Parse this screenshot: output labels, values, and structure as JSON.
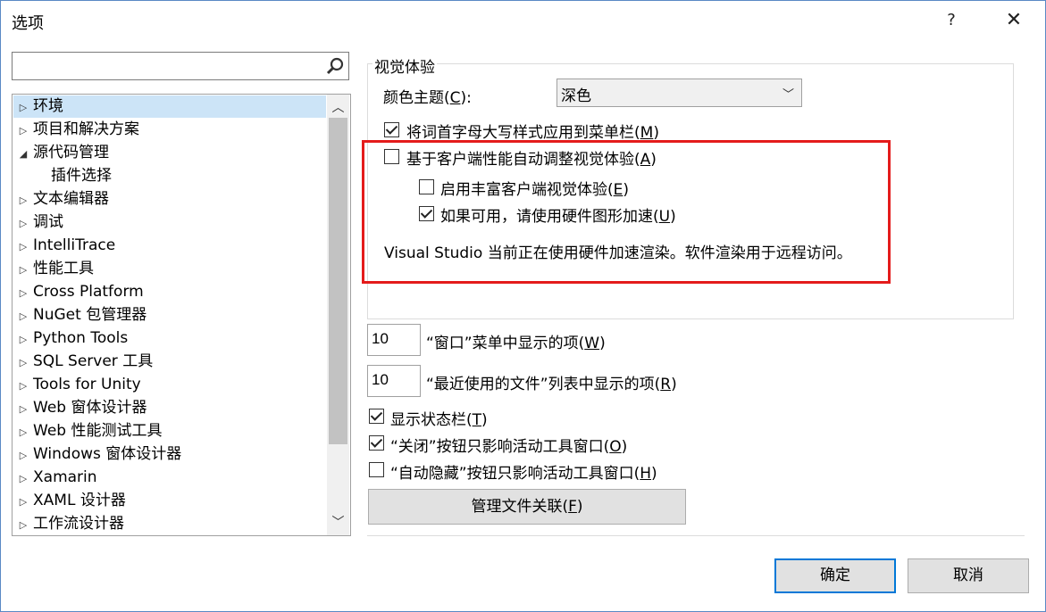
{
  "window": {
    "title": "选项",
    "help": "?",
    "close": "✕"
  },
  "search": {
    "value": "",
    "placeholder": ""
  },
  "tree": {
    "items": [
      {
        "label": "环境",
        "arrow": "▷"
      },
      {
        "label": "项目和解决方案",
        "arrow": "▷"
      },
      {
        "label": "源代码管理",
        "arrow": "◢"
      },
      {
        "label": "插件选择",
        "arrow": ""
      },
      {
        "label": "文本编辑器",
        "arrow": "▷"
      },
      {
        "label": "调试",
        "arrow": "▷"
      },
      {
        "label": "IntelliTrace",
        "arrow": "▷"
      },
      {
        "label": "性能工具",
        "arrow": "▷"
      },
      {
        "label": "Cross Platform",
        "arrow": "▷"
      },
      {
        "label": "NuGet 包管理器",
        "arrow": "▷"
      },
      {
        "label": "Python Tools",
        "arrow": "▷"
      },
      {
        "label": "SQL Server 工具",
        "arrow": "▷"
      },
      {
        "label": "Tools for Unity",
        "arrow": "▷"
      },
      {
        "label": "Web 窗体设计器",
        "arrow": "▷"
      },
      {
        "label": "Web 性能测试工具",
        "arrow": "▷"
      },
      {
        "label": "Windows 窗体设计器",
        "arrow": "▷"
      },
      {
        "label": "Xamarin",
        "arrow": "▷"
      },
      {
        "label": "XAML 设计器",
        "arrow": "▷"
      },
      {
        "label": "工作流设计器",
        "arrow": "▷"
      }
    ],
    "selected_index": 0
  },
  "visual": {
    "group_title": "视觉体验",
    "theme_label": "颜色主题(",
    "theme_key": "C",
    "theme_suffix": "):",
    "theme_value": "深色",
    "menu_caps": {
      "text": "将词首字母大写样式应用到菜单栏(",
      "key": "M",
      "end": ")",
      "checked": true
    },
    "auto_adjust": {
      "text": "基于客户端性能自动调整视觉体验(",
      "key": "A",
      "end": ")",
      "checked": false
    },
    "rich_client": {
      "text": "启用丰富客户端视觉体验(",
      "key": "E",
      "end": ")",
      "checked": false
    },
    "hw_accel": {
      "text": "如果可用，请使用硬件图形加速(",
      "key": "U",
      "end": ")",
      "checked": true
    },
    "info_text": "Visual Studio 当前正在使用硬件加速渲染。软件渲染用于远程访问。"
  },
  "window_items": {
    "value": "10",
    "text": "“窗口”菜单中显示的项(",
    "key": "W",
    "end": ")"
  },
  "recent_files": {
    "value": "10",
    "text": "“最近使用的文件”列表中显示的项(",
    "key": "R",
    "end": ")"
  },
  "status_bar": {
    "text": "显示状态栏(",
    "key": "T",
    "end": ")",
    "checked": true
  },
  "close_button": {
    "text": "“关闭”按钮只影响活动工具窗口(",
    "key": "O",
    "end": ")",
    "checked": true
  },
  "autohide_button": {
    "text": "“自动隐藏”按钮只影响活动工具窗口(",
    "key": "H",
    "end": ")",
    "checked": false
  },
  "file_assoc": {
    "text": "管理文件关联(",
    "key": "F",
    "end": ")"
  },
  "footer": {
    "ok": "确定",
    "cancel": "取消"
  }
}
